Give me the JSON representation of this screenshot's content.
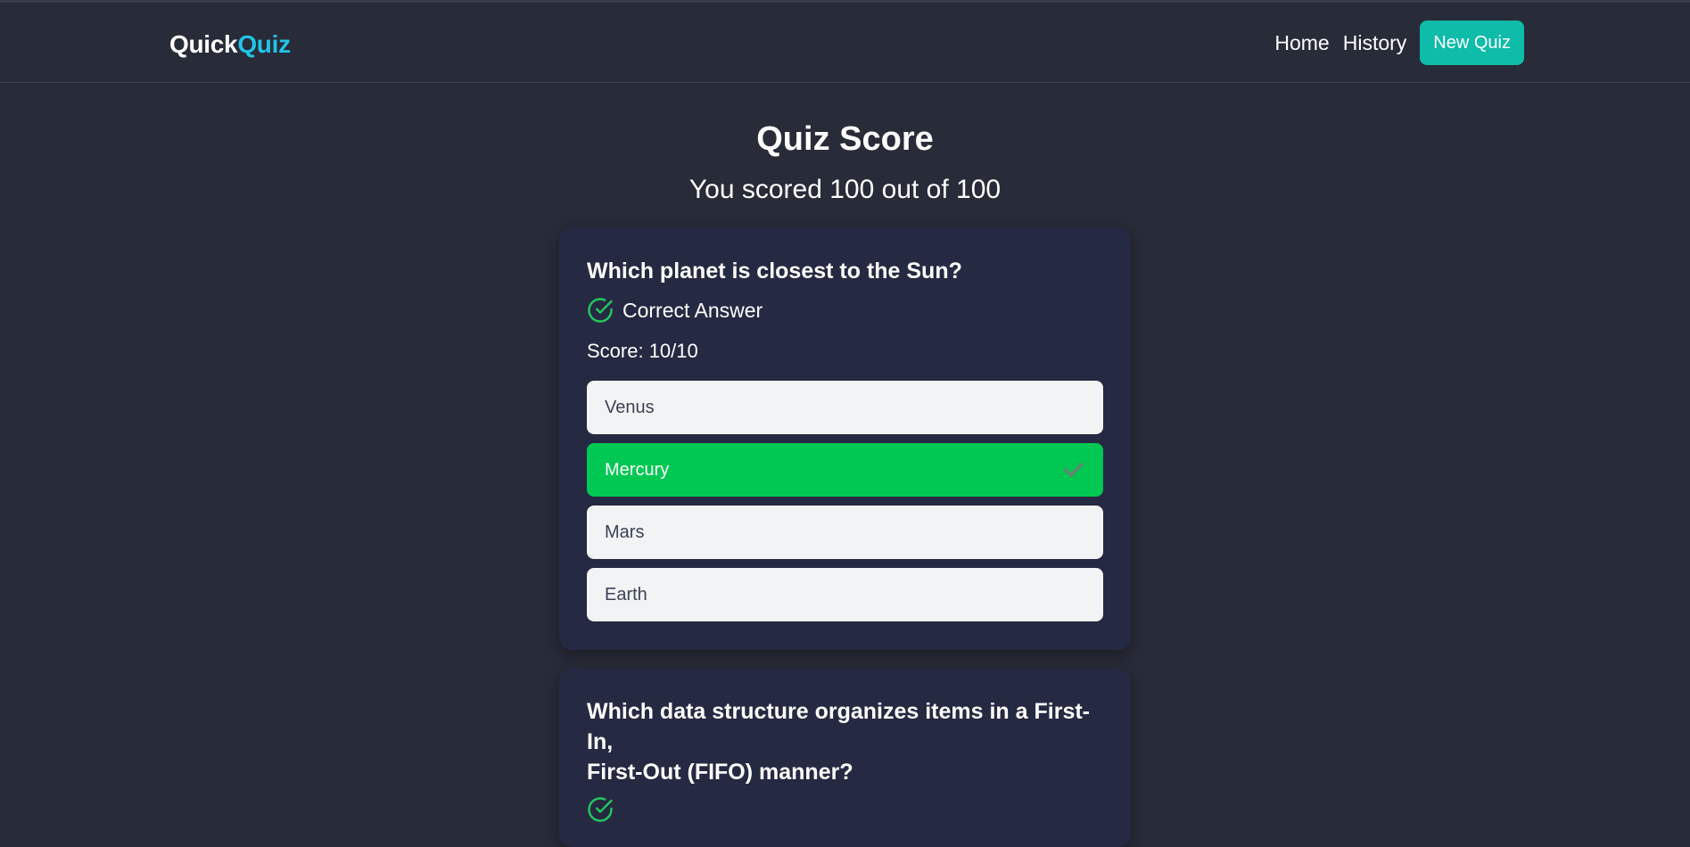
{
  "nav": {
    "logo_part1": "Quick",
    "logo_part2": "Quiz",
    "links": [
      "Home",
      "History"
    ],
    "new_quiz_label": "New Quiz"
  },
  "page": {
    "title": "Quiz Score",
    "score_summary": "You scored 100 out of 100"
  },
  "questions": [
    {
      "question": "Which planet is closest to the Sun?",
      "result": "Correct Answer",
      "score": "Score: 10/10",
      "options": [
        "Venus",
        "Mercury",
        "Mars",
        "Earth"
      ],
      "correct_option": "Mercury"
    },
    {
      "question_line1": "Which data structure organizes items in a First-In,",
      "question_line2": "First-Out (FIFO) manner?"
    }
  ],
  "colors": {
    "background": "#282b38",
    "card": "#262942",
    "accent_cyan": "#22c3e6",
    "button_teal": "#0fbba9",
    "correct_green": "#00c853"
  }
}
